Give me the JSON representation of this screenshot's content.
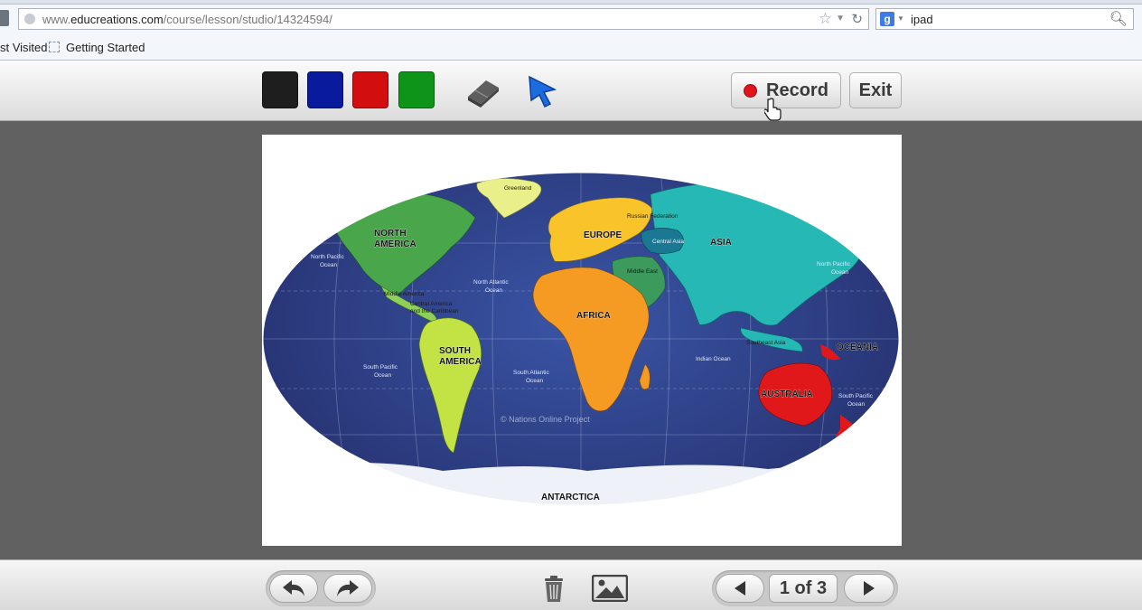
{
  "browser": {
    "url_prefix": "www.",
    "url_domain": "educreations.com",
    "url_path": "/course/lesson/studio/14324594/",
    "search_value": "ipad",
    "search_engine_glyph": "g",
    "bookmarks": [
      "st Visited",
      "Getting Started"
    ]
  },
  "toolbar": {
    "colors": [
      "#1e1e1e",
      "#0a1a9c",
      "#d20e0e",
      "#0e9418"
    ],
    "eraser_icon": "eraser-icon",
    "pointer_icon": "pointer-icon",
    "record_label": "Record",
    "exit_label": "Exit"
  },
  "map": {
    "continents": [
      "NORTH AMERICA",
      "SOUTH AMERICA",
      "EUROPE",
      "AFRICA",
      "ASIA",
      "AUSTRALIA",
      "OCEANIA",
      "ANTARCTICA"
    ],
    "regions": [
      "Greenland",
      "Russian Federation",
      "Central Asia",
      "Middle East",
      "Middle America",
      "Central America and the Caribbean",
      "Southeast Asia"
    ],
    "oceans": [
      "North Pacific Ocean",
      "North Atlantic Ocean",
      "North Pacific Ocean",
      "South Pacific Ocean",
      "South Atlantic Ocean",
      "Indian Ocean",
      "South Pacific Ocean"
    ],
    "watermark": "© Nations Online Project"
  },
  "bottom": {
    "page_current": 1,
    "page_total": 3,
    "page_label": "1 of 3",
    "icons": [
      "undo-icon",
      "redo-icon",
      "trash-icon",
      "image-icon",
      "prev-page-icon",
      "next-page-icon"
    ]
  }
}
